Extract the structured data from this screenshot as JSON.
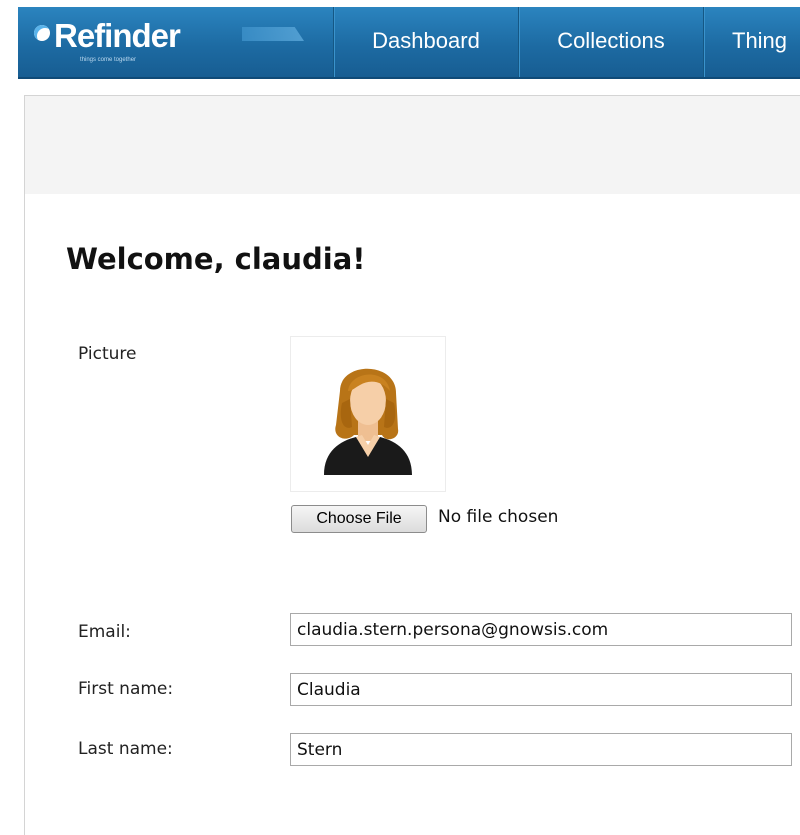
{
  "brand": {
    "name": "Refinder",
    "tagline": "things come together"
  },
  "nav": {
    "tabs": [
      {
        "label": "Dashboard"
      },
      {
        "label": "Collections"
      },
      {
        "label": "Thing"
      }
    ]
  },
  "page": {
    "welcome": "Welcome, claudia!"
  },
  "form": {
    "picture_label": "Picture",
    "choose_file_label": "Choose File",
    "no_file_text": "No file chosen",
    "email_label": "Email:",
    "email_value": "claudia.stern.persona@gnowsis.com",
    "first_name_label": "First name:",
    "first_name_value": "Claudia",
    "last_name_label": "Last name:",
    "last_name_value": "Stern"
  },
  "colors": {
    "navbar": "#1d6ba3",
    "avatar_hair": "#b87417",
    "avatar_skin": "#f6cfa8",
    "avatar_suit": "#1a1a1a"
  }
}
